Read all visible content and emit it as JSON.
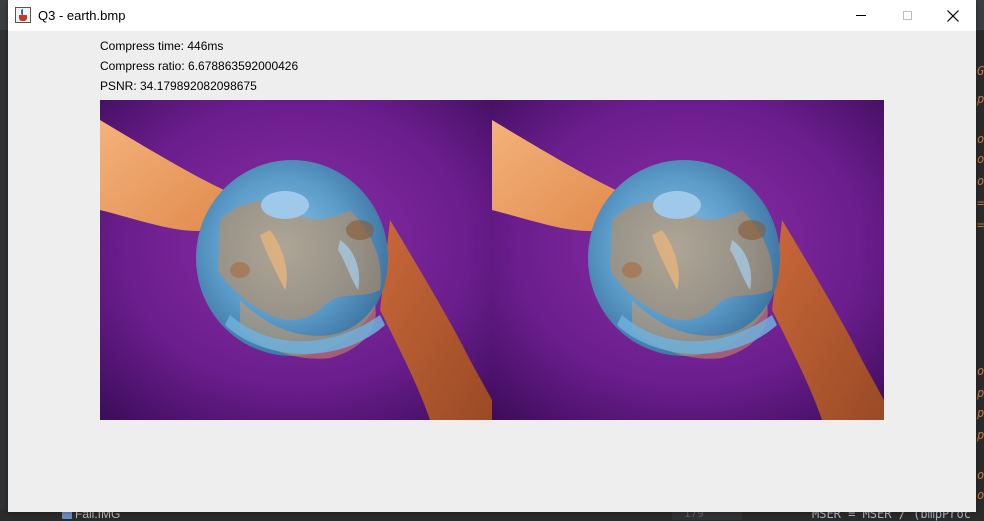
{
  "window": {
    "title": "Q3 - earth.bmp",
    "icon": "java-icon",
    "controls": {
      "minimize_icon": "minimize-icon",
      "maximize_icon": "maximize-icon",
      "close_icon": "close-icon"
    }
  },
  "stats": {
    "compress_time": "Compress time: 446ms",
    "compress_ratio": "Compress ratio: 6.678863592000426",
    "psnr": "PSNR: 34.179892082098675"
  },
  "images": [
    {
      "role": "original",
      "description_icon": "earth-hands-image"
    },
    {
      "role": "compressed",
      "description_icon": "earth-hands-image"
    }
  ],
  "background_ide": {
    "project_item": "Fall.IMG",
    "line_number": "179",
    "code_line": "MSER = MSER / (bmpProc",
    "right_edge_chars": [
      "G",
      "p",
      "o",
      "o",
      "o",
      "=",
      "=",
      "o",
      "p",
      "p",
      "p",
      "o",
      "o"
    ]
  },
  "colors": {
    "window_bg": "#eeeeee",
    "titlebar_bg": "#ffffff",
    "ide_bg": "#2b2b2b",
    "image_bg_purple": "#6d1c8a"
  }
}
